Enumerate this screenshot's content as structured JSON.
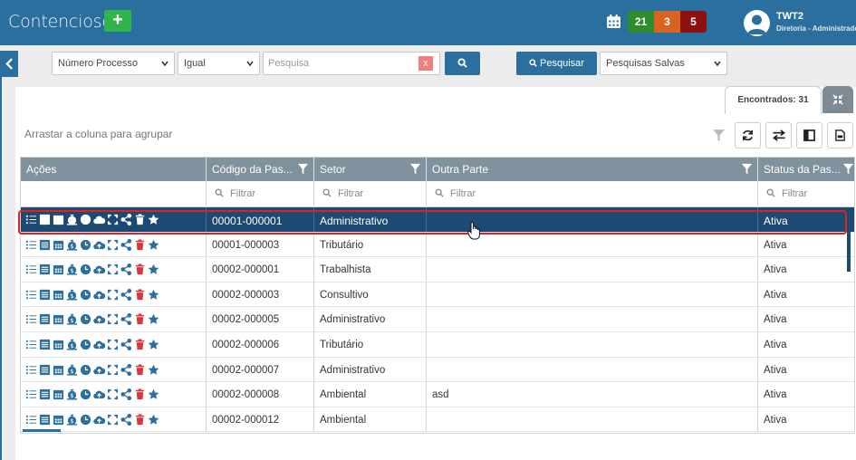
{
  "header": {
    "app_title": "Contencioso",
    "add_label": "+",
    "badges": [
      "21",
      "3",
      "5"
    ],
    "user_name": "TWT2",
    "user_role": "Diretoria - Administrador"
  },
  "filters": {
    "field_select": "Número Processo",
    "operator_select": "Igual",
    "search_placeholder": "Pesquisa",
    "clear_label": "x",
    "pesquisar_label": "Pesquisar",
    "saved_searches_select": "Pesquisas Salvas"
  },
  "panel": {
    "found_label": "Encontrados: 31",
    "group_hint": "Arrastar a coluna para agrupar"
  },
  "grid": {
    "columns": [
      "Ações",
      "Código da Pas...",
      "Setor",
      "Outra Parte",
      "Status da Pas..."
    ],
    "filter_placeholder": "Filtrar",
    "rows": [
      {
        "codigo": "00001-000001",
        "setor": "Administrativo",
        "outra_parte": "",
        "status": "Ativa"
      },
      {
        "codigo": "00001-000003",
        "setor": "Tributário",
        "outra_parte": "",
        "status": "Ativa"
      },
      {
        "codigo": "00002-000001",
        "setor": "Trabalhista",
        "outra_parte": "",
        "status": "Ativa"
      },
      {
        "codigo": "00002-000003",
        "setor": "Consultivo",
        "outra_parte": "",
        "status": "Ativa"
      },
      {
        "codigo": "00002-000005",
        "setor": "Administrativo",
        "outra_parte": "",
        "status": "Ativa"
      },
      {
        "codigo": "00002-000006",
        "setor": "Tributário",
        "outra_parte": "",
        "status": "Ativa"
      },
      {
        "codigo": "00002-000007",
        "setor": "Administrativo",
        "outra_parte": "",
        "status": "Ativa"
      },
      {
        "codigo": "00002-000008",
        "setor": "Ambiental",
        "outra_parte": "asd",
        "status": "Ativa"
      },
      {
        "codigo": "00002-000012",
        "setor": "Ambiental",
        "outra_parte": "",
        "status": "Ativa"
      }
    ],
    "action_icons": [
      "tasks-icon",
      "list-icon",
      "calendar-icon",
      "money-bag-icon",
      "clock-icon",
      "cloud-upload-icon",
      "expand-icon",
      "share-icon",
      "trash-icon",
      "star-icon"
    ]
  },
  "colors": {
    "primary": "#2b6f9e",
    "selected_row": "#1c4a72",
    "header_row": "#80929e",
    "add_green": "#2fb54a",
    "badge_green": "#2e8c2e",
    "badge_orange": "#d8641f",
    "badge_red": "#8c1111",
    "icon_blue": "#2b6f9e",
    "icon_red": "#d9363e"
  }
}
